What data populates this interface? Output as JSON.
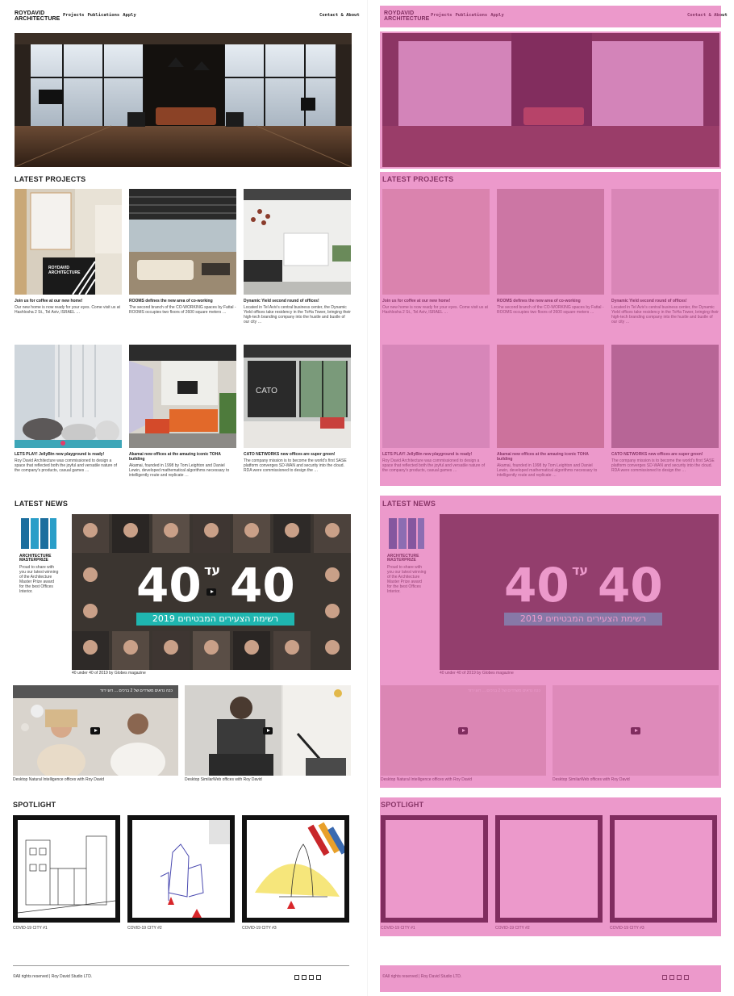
{
  "site": {
    "logo_line1": "ROYDAVID",
    "logo_line2": "ARCHITECTURE",
    "nav_left": [
      "Projects",
      "Publications",
      "Apply"
    ],
    "nav_right": "Contact & About"
  },
  "sections": {
    "latest_projects": "LATEST PROJECTS",
    "latest_news": "LATEST NEWS",
    "spotlight": "SPOTLIGHT"
  },
  "projects": [
    {
      "title": "Join us for coffee at our new home!",
      "desc": "Our new home is now ready for your eyes. Come visit us at Hashlosha 2 St., Tel Aviv, ISRAEL …"
    },
    {
      "title": "ROOMS defines the new area of co-working",
      "desc": "The second branch of the CO-WORKING spaces by Fattal - ROOMS occupies two floors of 2600 square meters …"
    },
    {
      "title": "Dynamic Yield second round of offices!",
      "desc": "Located in Tel Aviv's central business center, the Dynamic Yield offices take residency in the ToHa Tower, bringing their high-tech branding company into the hustle and bustle of our city …"
    },
    {
      "title": "LETS PLAY! JellyBtn new playground is ready!",
      "desc": "Roy David Architecture was commissioned to design a space that reflected both the joyful and versatile nature of the company's products, casual games …"
    },
    {
      "title": "Akamai new offices at the amazing iconic TOHA building",
      "desc": "Akamai, founded in 1998 by Tom Leighton and Daniel Lewin, developed mathematical algorithms necessary to intelligently route and replicate …"
    },
    {
      "title": "CATO NETWORKS new offices are super green!",
      "desc": "The company mission is to become the world's first SASE platform converges SD-WAN and security into the cloud. RDA were commissioned to design the …"
    }
  ],
  "news": {
    "prize_label_1": "ARCHITECTURE",
    "prize_label_2": "MASTERPRIZE",
    "prize_text": "Proud to share with you our latest winning of the Architecture Master Prize award for the best Offices Interior.",
    "video_big_number": "40",
    "video_big_mid": "עד",
    "video_subtitle": "רשימת הצעירים המבטיחים 2019",
    "video_main_caption": "40 under 40 of 2019 by Globes magazine",
    "videos": [
      {
        "caption": "Desktop Natural Intelligence offices with Roy David",
        "overlay": "ככה נראים משרדים של 2 ברכים ... רועי דוד"
      },
      {
        "caption": "Desktop SimilarWeb offices with Roy David",
        "overlay": ""
      }
    ]
  },
  "spotlight": [
    "COVID-19 CITY #1",
    "COVID-19 CITY #2",
    "COVID-19 CITY #3"
  ],
  "footer": {
    "copyright": "©All rights reserved | Roy David Studio LTD."
  },
  "colors": {
    "overlay": "#dc46a0",
    "teal": "#1fb6b0",
    "logo_blue": "#1c6e9e"
  }
}
